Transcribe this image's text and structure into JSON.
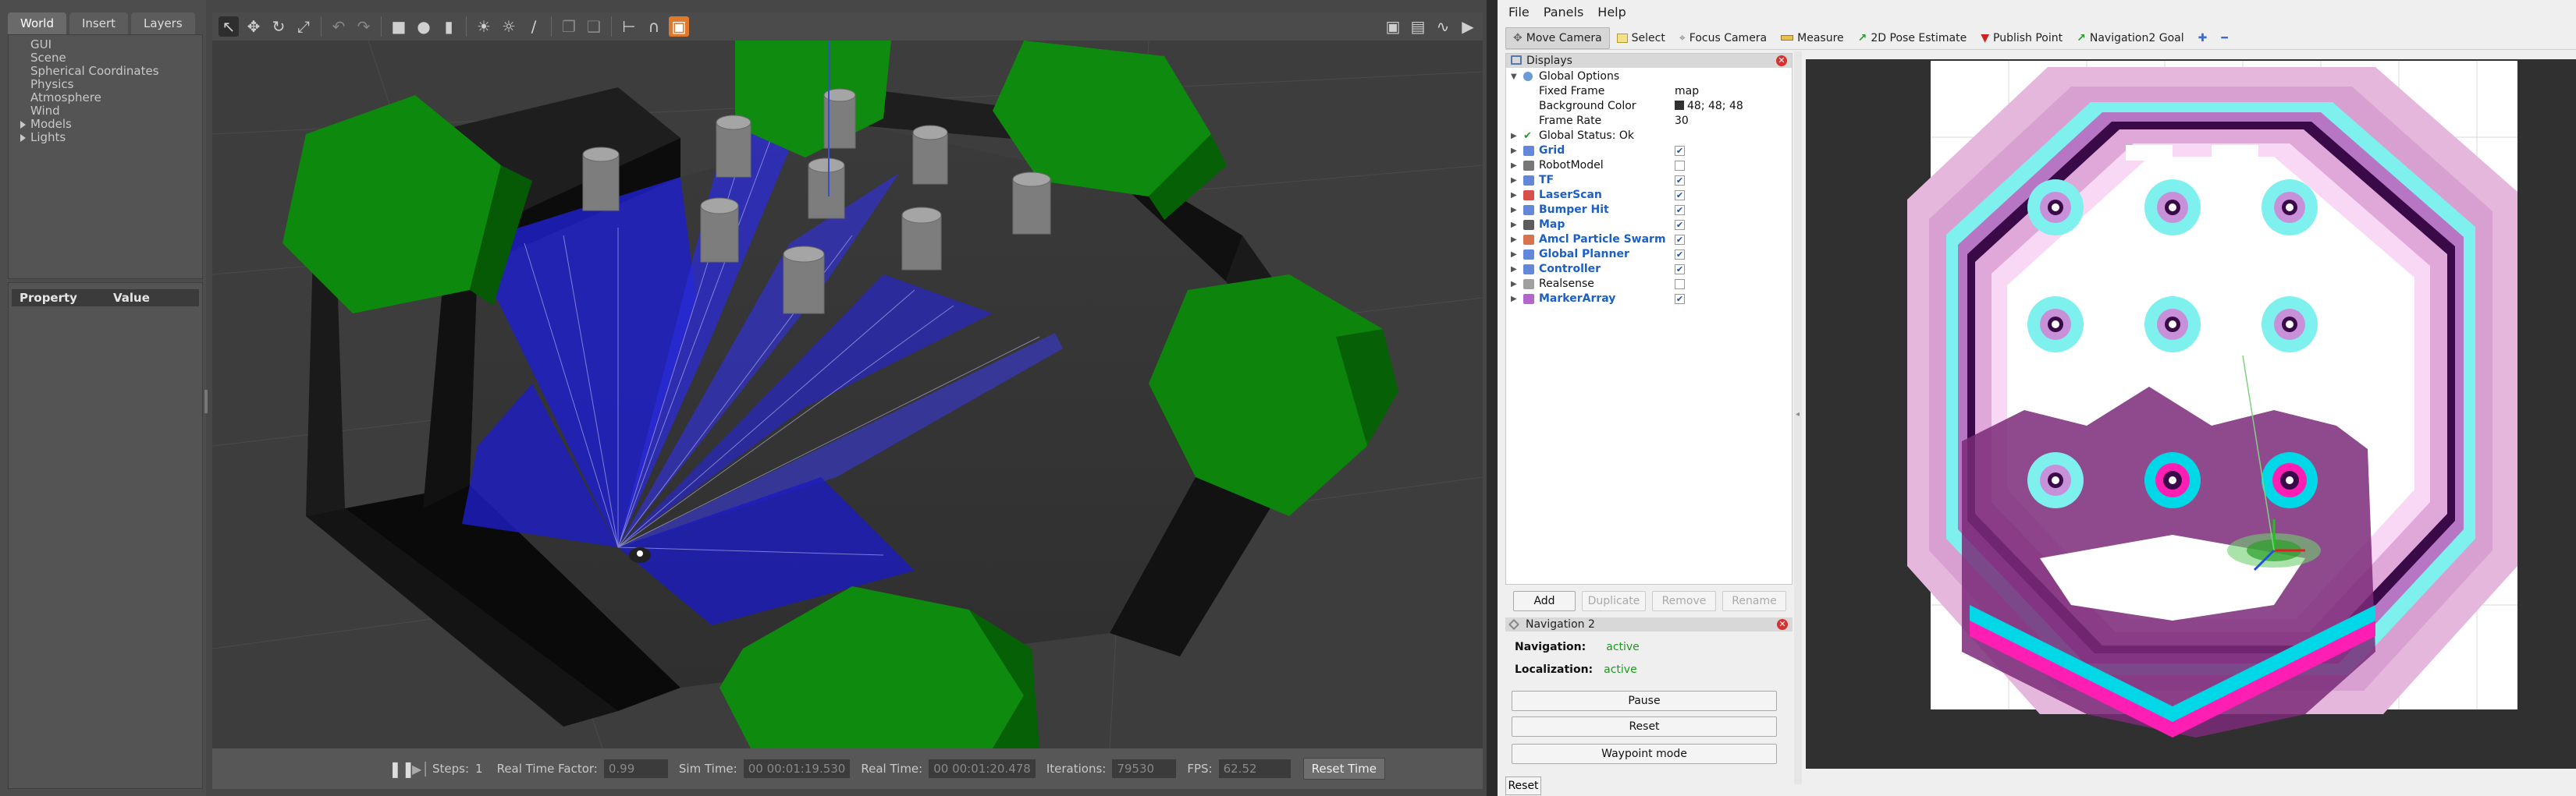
{
  "gazebo": {
    "tabs": [
      "World",
      "Insert",
      "Layers"
    ],
    "world_tree": [
      "GUI",
      "Scene",
      "Spherical Coordinates",
      "Physics",
      "Atmosphere",
      "Wind",
      "Models",
      "Lights"
    ],
    "property_headers": [
      "Property",
      "Value"
    ],
    "toolbar_icons": [
      "select-arrow",
      "translate",
      "rotate",
      "scale",
      "undo",
      "redo",
      "box",
      "sphere",
      "cylinder",
      "point-light",
      "spot-light",
      "directional-light",
      "copy",
      "paste",
      "align",
      "snap",
      "change-view",
      "screenshot",
      "log",
      "plot",
      "video"
    ],
    "bottom": {
      "steps_label": "Steps:",
      "steps_value": "1",
      "rtf_label": "Real Time Factor:",
      "rtf_value": "0.99",
      "sim_label": "Sim Time:",
      "sim_value": "00 00:01:19.530",
      "real_label": "Real Time:",
      "real_value": "00 00:01:20.478",
      "iter_label": "Iterations:",
      "iter_value": "79530",
      "fps_label": "FPS:",
      "fps_value": "62.52",
      "reset_time": "Reset Time"
    }
  },
  "rviz": {
    "menu": [
      "File",
      "Panels",
      "Help"
    ],
    "tools": [
      "Move Camera",
      "Select",
      "Focus Camera",
      "Measure",
      "2D Pose Estimate",
      "Publish Point",
      "Navigation2 Goal"
    ],
    "displays_title": "Displays",
    "global_options": "Global Options",
    "options": [
      {
        "name": "Fixed Frame",
        "value": "map"
      },
      {
        "name": "Background Color",
        "value": "48; 48; 48"
      },
      {
        "name": "Frame Rate",
        "value": "30"
      }
    ],
    "global_status": "Global Status: Ok",
    "displays": [
      {
        "name": "Grid",
        "checked": true,
        "blue": true
      },
      {
        "name": "RobotModel",
        "checked": false,
        "blue": false
      },
      {
        "name": "TF",
        "checked": true,
        "blue": true
      },
      {
        "name": "LaserScan",
        "checked": true,
        "blue": true
      },
      {
        "name": "Bumper Hit",
        "checked": true,
        "blue": true
      },
      {
        "name": "Map",
        "checked": true,
        "blue": true
      },
      {
        "name": "Amcl Particle Swarm",
        "checked": true,
        "blue": true
      },
      {
        "name": "Global Planner",
        "checked": true,
        "blue": true
      },
      {
        "name": "Controller",
        "checked": true,
        "blue": true
      },
      {
        "name": "Realsense",
        "checked": false,
        "blue": false
      },
      {
        "name": "MarkerArray",
        "checked": true,
        "blue": true
      }
    ],
    "display_buttons": [
      "Add",
      "Duplicate",
      "Remove",
      "Rename"
    ],
    "nav_title": "Navigation 2",
    "navigation_label": "Navigation:",
    "navigation_status": "active",
    "localization_label": "Localization:",
    "localization_status": "active",
    "nav_buttons": [
      "Pause",
      "Reset",
      "Waypoint mode"
    ],
    "reset": "Reset",
    "background_color": "#303030"
  }
}
